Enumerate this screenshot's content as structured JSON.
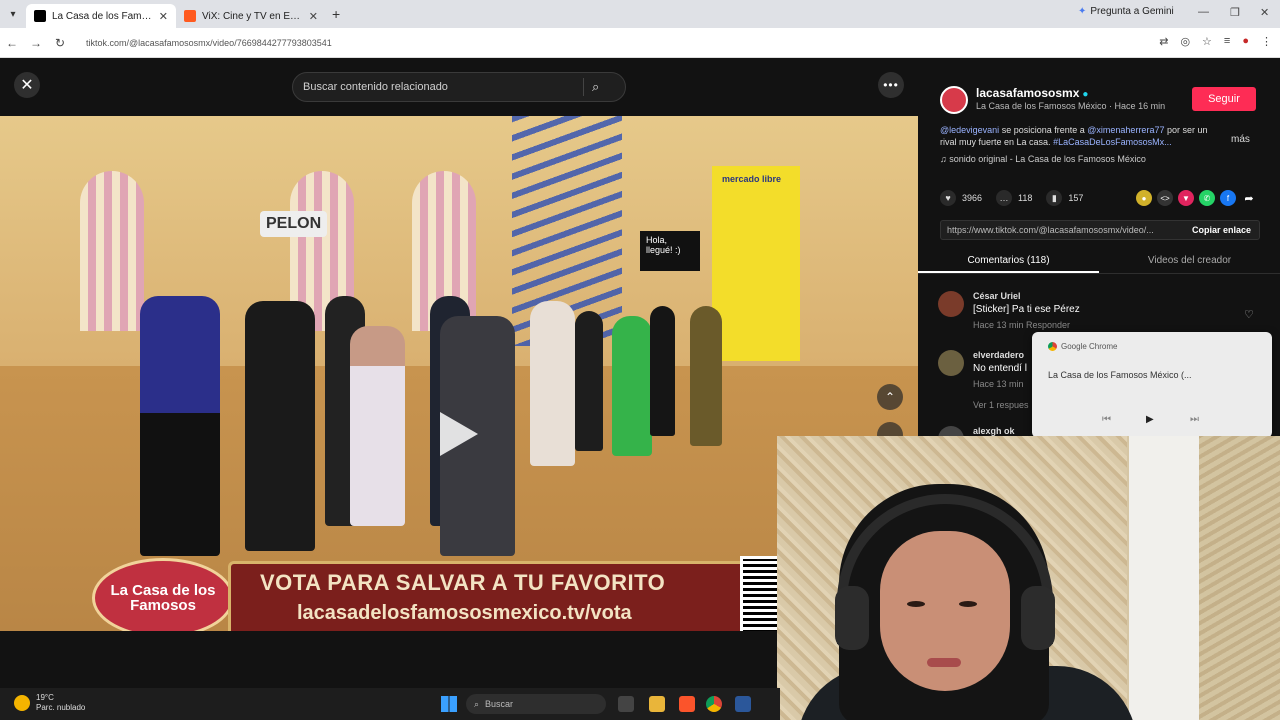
{
  "browser": {
    "tabs": [
      {
        "title": "La Casa de los Famosos Méx",
        "active": true
      },
      {
        "title": "ViX: Cine y TV en Español",
        "active": false
      }
    ],
    "gemini_label": "Pregunta a Gemini",
    "url": "tiktok.com/@lacasafamososmx/video/7669844277793803541"
  },
  "viewer": {
    "search_placeholder": "Buscar contenido relacionado",
    "close_icon": "✕",
    "more_icon": "•••"
  },
  "video": {
    "sign_pelon": "PELON",
    "hola_sign": "Hola, llegué! :)",
    "board_text": "mercado libre",
    "logo_text": "La Casa de los Famosos",
    "banner_line1": "VOTA PARA SALVAR A TU FAVORITO",
    "banner_line2": "lacasadelosfamososmexico.tv/vota"
  },
  "panel": {
    "username": "lacasafamososmx",
    "subtitle": "La Casa de los Famosos México · Hace 16 min",
    "follow_label": "Seguir",
    "caption_mention1": "@ledevigevani",
    "caption_mid": "se posiciona frente a",
    "caption_mention2": "@ximenaherrera77",
    "caption_rest": "por ser un rival muy fuerte en La casa.",
    "caption_tags": "#LaCasaDeLosFamososMx...",
    "mas_label": "más",
    "music": "sonido original - La Casa de los Famosos México",
    "likes": "3966",
    "comments": "118",
    "saves": "157",
    "link": "https://www.tiktok.com/@lacasafamososmx/video/...",
    "copy_label": "Copiar enlace",
    "tab_comments": "Comentarios (118)",
    "tab_creator": "Videos del creador"
  },
  "comments": [
    {
      "name": "César Uriel",
      "text": "[Sticker] Pa ti ese Pérez",
      "meta": "Hace 13 min    Responder"
    },
    {
      "name": "elverdadero",
      "text": "No entendí l",
      "meta": "Hace 13 min",
      "replies": "Ver 1 respues"
    },
    {
      "name": "alexgh ok",
      "text": "",
      "meta": ""
    }
  ],
  "media_popup": {
    "app": "Google Chrome",
    "title": "La Casa de los Famosos México (..."
  },
  "taskbar": {
    "temp": "19°C",
    "weather": "Parc. nublado",
    "search_placeholder": "Buscar"
  },
  "colors": {
    "follow": "#fe2c55",
    "panel_bg": "#121212",
    "banner": "#7b1f1c"
  }
}
